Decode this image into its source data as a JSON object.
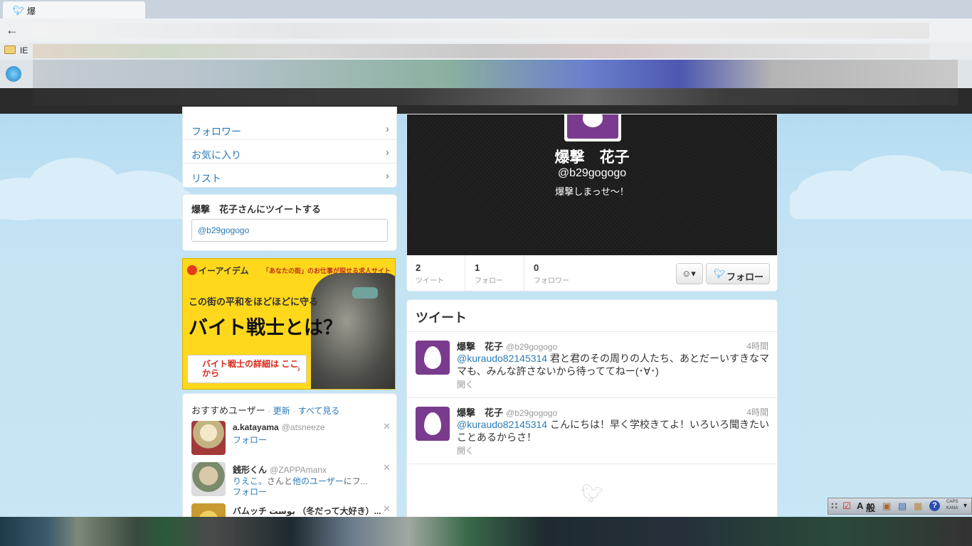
{
  "browser": {
    "tab_title": "爆",
    "bookmark_label": "IE"
  },
  "left_nav": {
    "items": [
      {
        "label": "フォロワー"
      },
      {
        "label": "お気に入り"
      },
      {
        "label": "リスト"
      }
    ]
  },
  "tweet_to": {
    "title": "爆撃　花子さんにツイートする",
    "input_value": "@b29gogogo"
  },
  "ad": {
    "brand": "イーアイデム",
    "tagline": "「あなたの街」のお仕事が探せる求人サイト",
    "line1": "この街の平和をほどほどに守る",
    "line2": "バイト戦士とは？",
    "button": "バイト戦士の詳細は ここから"
  },
  "who_to_follow": {
    "title": "おすすめユーザー",
    "refresh": "更新",
    "view_all": "すべて見る",
    "users": [
      {
        "name": "a.katayama",
        "handle": "@atsneeze",
        "context": "",
        "follow": "フォロー",
        "avatar_color": "#c8b48a"
      },
      {
        "name": "銭形くん",
        "handle": "@ZAPPAmanx",
        "context_link1": "りえこ。",
        "context_mid": "さんと",
        "context_link2": "他のユーザー",
        "context_tail": "にフ...",
        "follow": "フォロー",
        "avatar_color": "#9aa98a"
      },
      {
        "name": "バムッチ بوست （冬だって大好き）...",
        "handle": "",
        "follow": "",
        "avatar_color": "#d8b04a"
      }
    ]
  },
  "profile": {
    "name": "爆撃　花子",
    "handle": "@b29gogogo",
    "bio": "爆撃しまっせ〜！",
    "stats": [
      {
        "value": "2",
        "label": "ツイート"
      },
      {
        "value": "1",
        "label": "フォロー"
      },
      {
        "value": "0",
        "label": "フォロワー"
      }
    ],
    "follow_button": "フォロー",
    "avatar_color": "#7a3b8e"
  },
  "tweets": {
    "heading": "ツイート",
    "items": [
      {
        "name": "爆撃　花子",
        "handle": "@b29gogogo",
        "time": "4時間",
        "mention": "@kuraudo82145314",
        "text": " 君と君のその周りの人たち、あとだーいすきなママも、みんな許さないから待っててねー(･∀･)",
        "open": "開く"
      },
      {
        "name": "爆撃　花子",
        "handle": "@b29gogogo",
        "time": "4時間",
        "mention": "@kuraudo82145314",
        "text": " こんにちは！早く学校きてよ！いろいろ聞きたいことあるからさ！",
        "open": "開く"
      }
    ]
  },
  "ime_bar": {
    "mode": "A",
    "kana": "般",
    "caps": "CAPS",
    "kana_label": "KANA"
  }
}
